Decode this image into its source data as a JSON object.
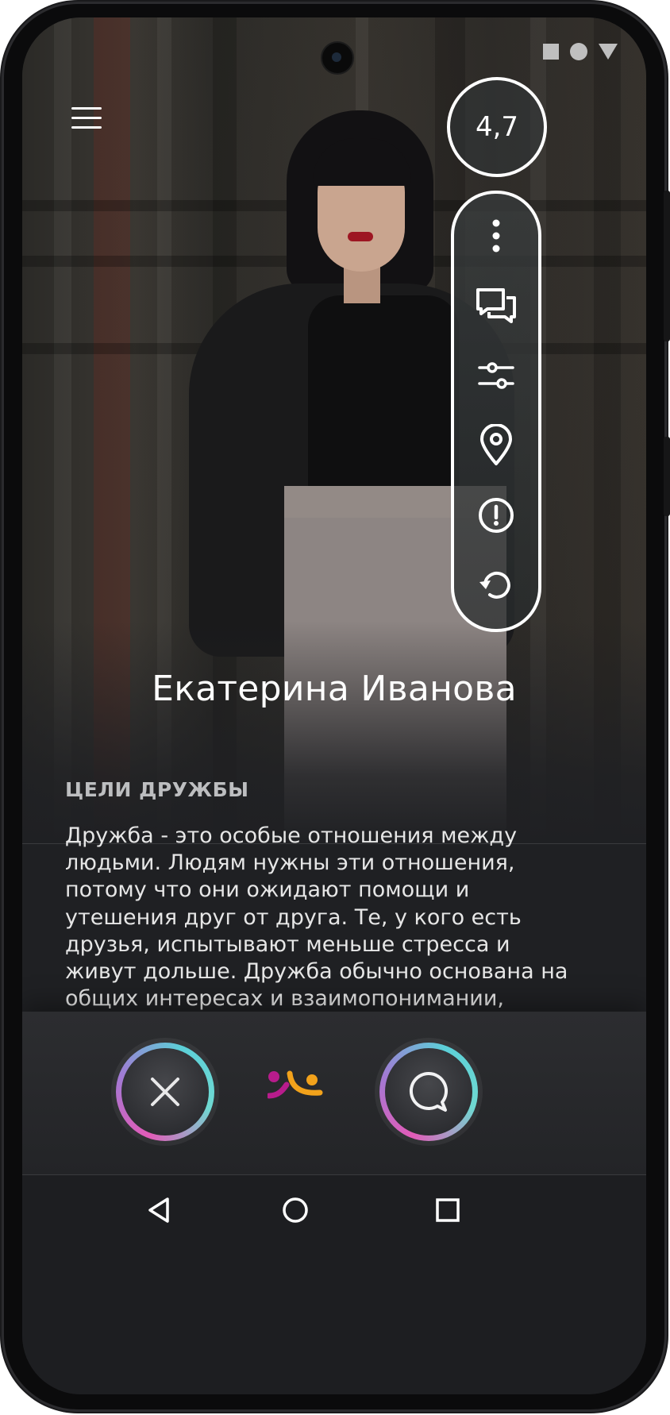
{
  "status_bar": {
    "icons": [
      "square-icon",
      "circle-icon",
      "triangle-icon"
    ]
  },
  "profile": {
    "name": "Екатерина Иванова",
    "rating": "4,7"
  },
  "side_toolbar": {
    "items": [
      {
        "name": "more-icon"
      },
      {
        "name": "chat-bubbles-icon"
      },
      {
        "name": "filter-sliders-icon"
      },
      {
        "name": "location-pin-icon"
      },
      {
        "name": "report-icon"
      },
      {
        "name": "undo-icon"
      }
    ]
  },
  "section": {
    "title": "ЦЕЛИ ДРУЖБЫ",
    "body": "Дружба - это особые отношения между людьми. Людям нужны эти отношения, потому что они ожидают помощи и утешения друг от друга. Те, у кого есть друзья, испытывают меньше стресса и живут дольше. Дружба обычно основана на общих интересах и взаимопонимании, истинном поощрении и симпатии. Они говорят: “Дружба - это не что-то"
  },
  "actions": {
    "dismiss": "close-icon",
    "message": "message-icon"
  },
  "colors": {
    "accent_pink": "#e25bb8",
    "accent_teal": "#5cd0d8",
    "logo_magenta": "#b81c8c",
    "logo_orange": "#f2a21b",
    "background": "#1f2023"
  },
  "nav": {
    "icons": [
      "back-icon",
      "home-icon",
      "recents-icon"
    ]
  }
}
